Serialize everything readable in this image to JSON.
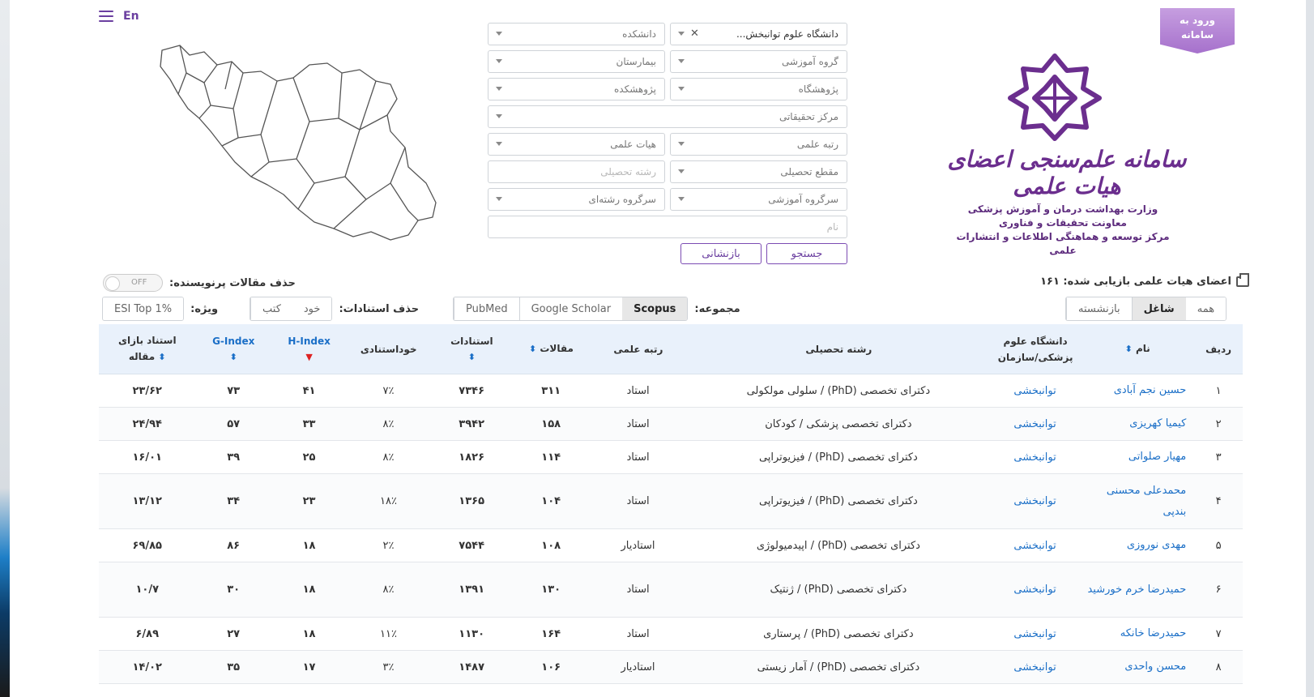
{
  "header": {
    "lang": "En",
    "login_label_line1": "ورود به",
    "login_label_line2": "سامانه",
    "title": "سامانه علم‌سنجی اعضای هیات علمی",
    "org_line1": "وزارت بهداشت درمان و آموزش پزشکی",
    "org_line2": "معاونت تحقیقات و فناوری",
    "org_line3": "مرکز توسعه و هماهنگی اطلاعات و انتشارات علمی"
  },
  "filters": {
    "university": "دانشگاه علوم توانبخش...",
    "faculty": "دانشکده",
    "edu_group": "گروه آموزشی",
    "hospital": "بیمارستان",
    "research_institute": "پژوهشگاه",
    "research_center_small": "پژوهشکده",
    "research_center": "مرکز تحقیقاتی",
    "academic_rank": "رتبه علمی",
    "faculty_board": "هیات علمی",
    "degree": "مقطع تحصیلی",
    "field": "رشته تحصیلی",
    "edu_supergroup": "سرگروه آموزشی",
    "field_supergroup": "سرگروه رشته‌ای",
    "name_placeholder": "نام",
    "search_btn": "جستجو",
    "reset_btn": "بازنشانی"
  },
  "toolbar": {
    "count_label": "اعضای هیات علمی بازیابی شده: ۱۶۱",
    "remove_prolific_label": "حذف مقالات پرنویسنده:",
    "toggle_state": "OFF",
    "status_tabs": [
      "همه",
      "شاغل",
      "بازنشسته"
    ],
    "status_active": 1,
    "collection_label": "مجموعه:",
    "collections": [
      "Scopus",
      "Google Scholar",
      "PubMed"
    ],
    "collection_active": 0,
    "remove_cite_label": "حذف استنادات:",
    "remove_cite_options": [
      "خود",
      "کتب"
    ],
    "special_label": "ویژه:",
    "special_option": "ESI Top 1%"
  },
  "table": {
    "headers": {
      "rad": "ردیف",
      "name": "نام",
      "univ_line1": "دانشگاه علوم",
      "univ_line2": "پزشکی/سازمان",
      "field": "رشته تحصیلی",
      "rank": "رتبه علمی",
      "articles": "مقالات",
      "citations": "استنادات",
      "self_cite": "خوداستنادی",
      "h_index": "H-Index",
      "g_index": "G-Index",
      "cpa_line1": "استناد بازای",
      "cpa_line2": "مقاله"
    },
    "rows": [
      {
        "rad": "۱",
        "name": "حسین نجم آبادی",
        "univ": "توانبخشی",
        "field": "دکترای تخصصی (PhD) / سلولی مولکولی",
        "rank": "استاد",
        "articles": "۳۱۱",
        "citations": "۷۳۴۶",
        "self": "۷٪",
        "h": "۴۱",
        "g": "۷۳",
        "cpa": "۲۳/۶۲",
        "tall": false
      },
      {
        "rad": "۲",
        "name": "کیمیا کهریزی",
        "univ": "توانبخشی",
        "field": "دکترای تخصصی پزشکی / کودکان",
        "rank": "استاد",
        "articles": "۱۵۸",
        "citations": "۳۹۴۲",
        "self": "۸٪",
        "h": "۳۳",
        "g": "۵۷",
        "cpa": "۲۴/۹۴",
        "tall": false
      },
      {
        "rad": "۳",
        "name": "مهیار صلواتی",
        "univ": "توانبخشی",
        "field": "دکترای تخصصی (PhD) / فیزیوتراپی",
        "rank": "استاد",
        "articles": "۱۱۴",
        "citations": "۱۸۲۶",
        "self": "۸٪",
        "h": "۲۵",
        "g": "۳۹",
        "cpa": "۱۶/۰۱",
        "tall": false
      },
      {
        "rad": "۴",
        "name": "محمدعلی محسنی بندپی",
        "univ": "توانبخشی",
        "field": "دکترای تخصصی (PhD) / فیزیوتراپی",
        "rank": "استاد",
        "articles": "۱۰۴",
        "citations": "۱۳۶۵",
        "self": "۱۸٪",
        "h": "۲۳",
        "g": "۳۴",
        "cpa": "۱۳/۱۲",
        "tall": true
      },
      {
        "rad": "۵",
        "name": "مهدی نوروزی",
        "univ": "توانبخشی",
        "field": "دکترای تخصصی (PhD) / اپیدمیولوژی",
        "rank": "استادیار",
        "articles": "۱۰۸",
        "citations": "۷۵۴۴",
        "self": "۲٪",
        "h": "۱۸",
        "g": "۸۶",
        "cpa": "۶۹/۸۵",
        "tall": false
      },
      {
        "rad": "۶",
        "name": "حمیدرضا خرم خورشید",
        "univ": "توانبخشی",
        "field": "دکترای تخصصی (PhD) / ژنتیک",
        "rank": "استاد",
        "articles": "۱۳۰",
        "citations": "۱۳۹۱",
        "self": "۸٪",
        "h": "۱۸",
        "g": "۳۰",
        "cpa": "۱۰/۷",
        "tall": true
      },
      {
        "rad": "۷",
        "name": "حمیدرضا خانکه",
        "univ": "توانبخشی",
        "field": "دکترای تخصصی (PhD) / پرستاری",
        "rank": "استاد",
        "articles": "۱۶۴",
        "citations": "۱۱۳۰",
        "self": "۱۱٪",
        "h": "۱۸",
        "g": "۲۷",
        "cpa": "۶/۸۹",
        "tall": false
      },
      {
        "rad": "۸",
        "name": "محسن واحدی",
        "univ": "توانبخشی",
        "field": "دکترای تخصصی (PhD) / آمار زیستی",
        "rank": "استادیار",
        "articles": "۱۰۶",
        "citations": "۱۴۸۷",
        "self": "۳٪",
        "h": "۱۷",
        "g": "۳۵",
        "cpa": "۱۴/۰۲",
        "tall": false
      }
    ]
  },
  "colors": {
    "brand_purple": "#6b2e8e",
    "link_blue": "#1b6fc7",
    "header_bg": "#e9f1fb"
  }
}
